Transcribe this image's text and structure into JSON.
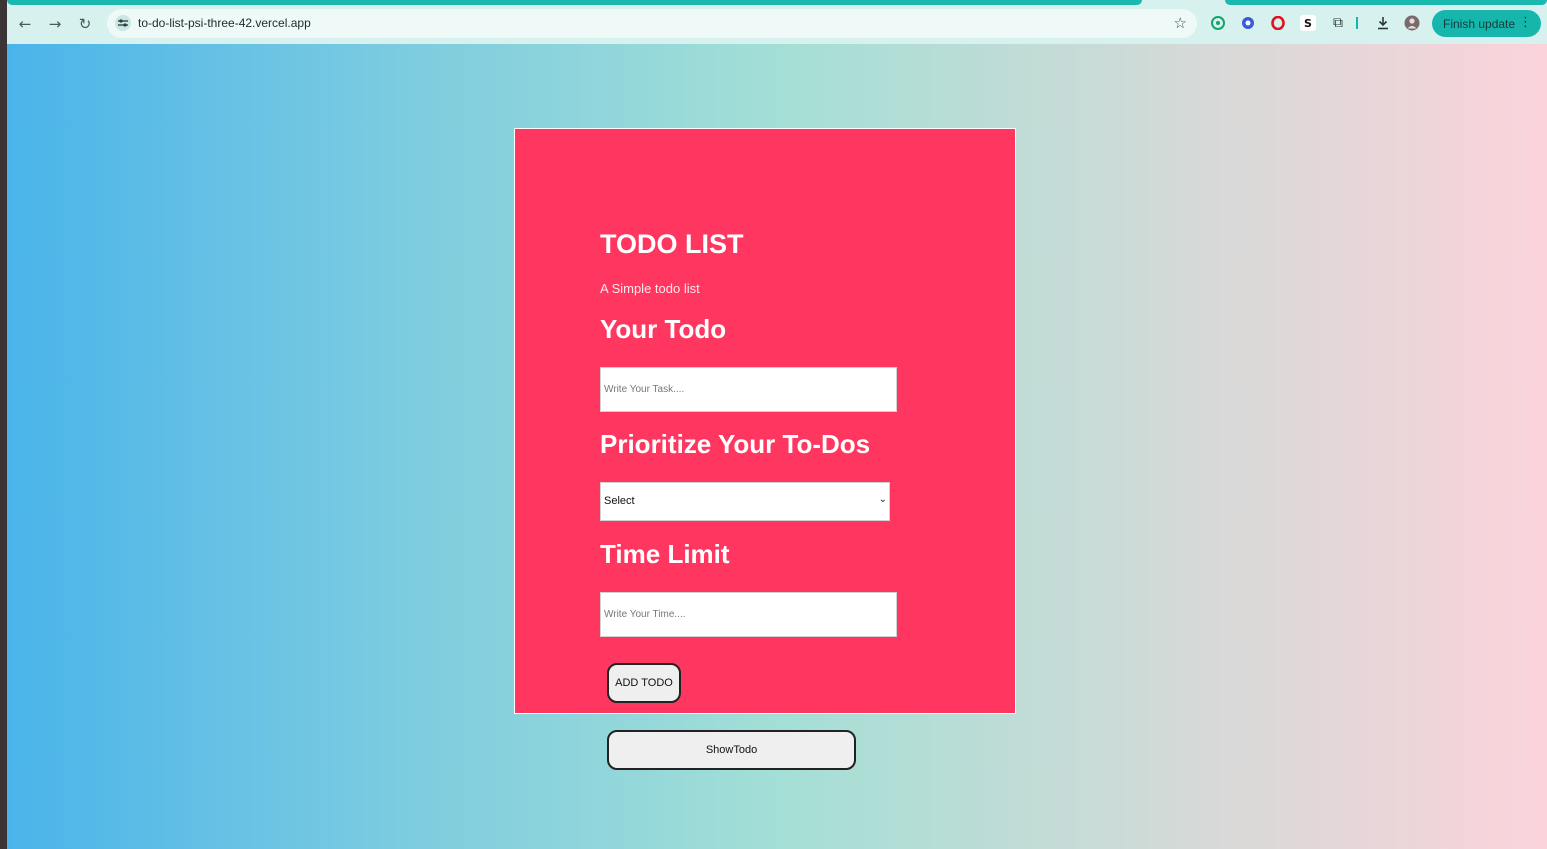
{
  "browser": {
    "url": "to-do-list-psi-three-42.vercel.app",
    "update_button_label": "Finish update",
    "icons": {
      "back": "arrow-left-icon",
      "forward": "arrow-right-icon",
      "reload": "reload-icon",
      "site_info": "tune-icon",
      "bookmark": "star-icon",
      "extensions": [
        "grammarly-icon",
        "extension-blue-icon",
        "opera-icon",
        "s-extension-icon",
        "puzzle-icon"
      ],
      "download": "download-icon",
      "profile": "profile-icon",
      "menu": "more-vert-icon"
    },
    "s_extension_label": "S",
    "accent_color": "#1bb8b0"
  },
  "app": {
    "title": "TODO LIST",
    "subtitle": "A Simple todo list",
    "todo_heading": "Your Todo",
    "task_placeholder": "Write Your Task....",
    "priority_heading": "Prioritize Your To-Dos",
    "priority_selected": "Select",
    "time_heading": "Time Limit",
    "time_placeholder": "Write Your Time....",
    "add_button": "ADD TODO",
    "show_button": "ShowTodo",
    "card_color": "#ff3760"
  }
}
